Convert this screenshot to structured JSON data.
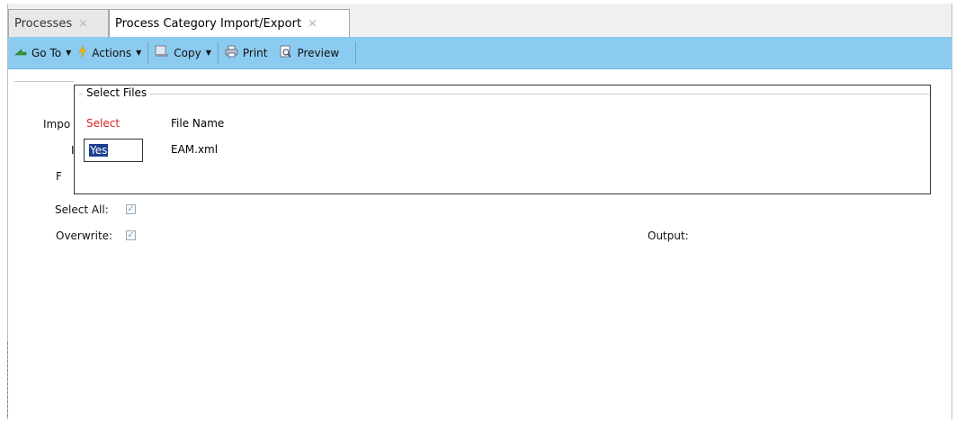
{
  "tabs": [
    {
      "label": "Processes",
      "close": "×",
      "active": false
    },
    {
      "label": "Process Category Import/Export",
      "close": "×",
      "active": true
    }
  ],
  "toolbar": {
    "goto": "Go To",
    "actions": "Actions",
    "copy": "Copy",
    "print": "Print",
    "preview": "Preview"
  },
  "form": {
    "import_partial": "Impo",
    "row2_partial": "I",
    "row3_partial": "F",
    "select_all_label": "Select All:",
    "select_all_checked": true,
    "overwrite_label": "Overwrite:",
    "overwrite_checked": true,
    "output_label": "Output:"
  },
  "popup": {
    "group_title": "Select Files",
    "columns": {
      "select": "Select",
      "file_name": "File Name"
    },
    "rows": [
      {
        "select": "Yes",
        "file_name": "EAM.xml"
      }
    ]
  },
  "colors": {
    "toolbar_bg": "#8ccbf0",
    "select_header": "#e02020",
    "selection_highlight": "#1a3f8f"
  }
}
